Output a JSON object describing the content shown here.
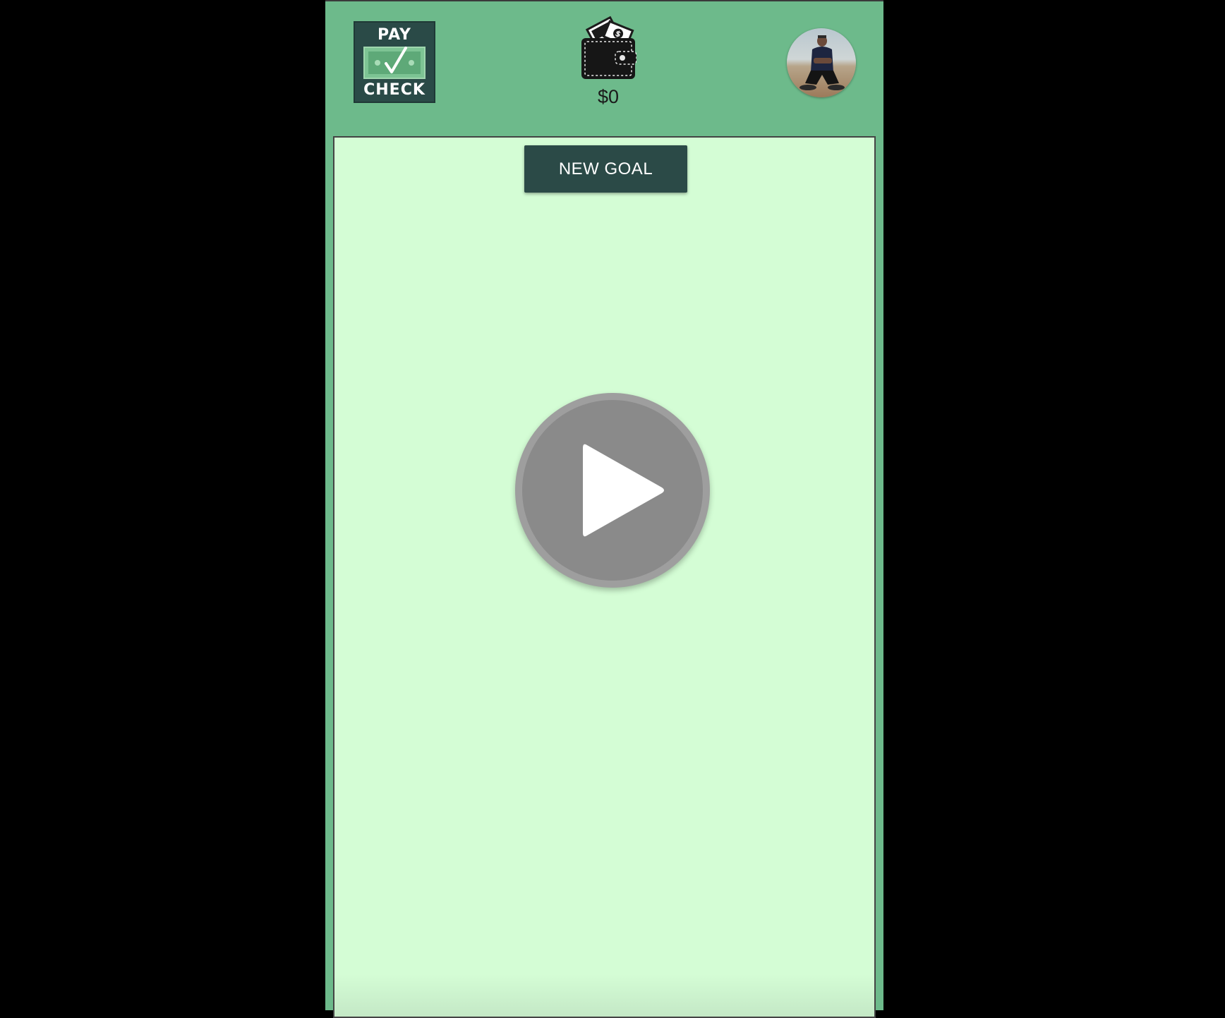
{
  "app": {
    "logo": {
      "top_text": "PAY",
      "bottom_text": "CHECK",
      "icon": "check-bill-icon"
    },
    "wallet": {
      "icon": "wallet-icon",
      "balance": "$0"
    },
    "avatar": {
      "icon": "user-avatar"
    }
  },
  "main": {
    "new_goal_label": "NEW GOAL"
  },
  "video": {
    "icon": "play-icon"
  },
  "colors": {
    "page_background": "#000000",
    "header_green": "#6dba8b",
    "content_green": "#d4fdd5",
    "dark_teal": "#2b4a47",
    "play_gray": "#8a8a8a"
  }
}
